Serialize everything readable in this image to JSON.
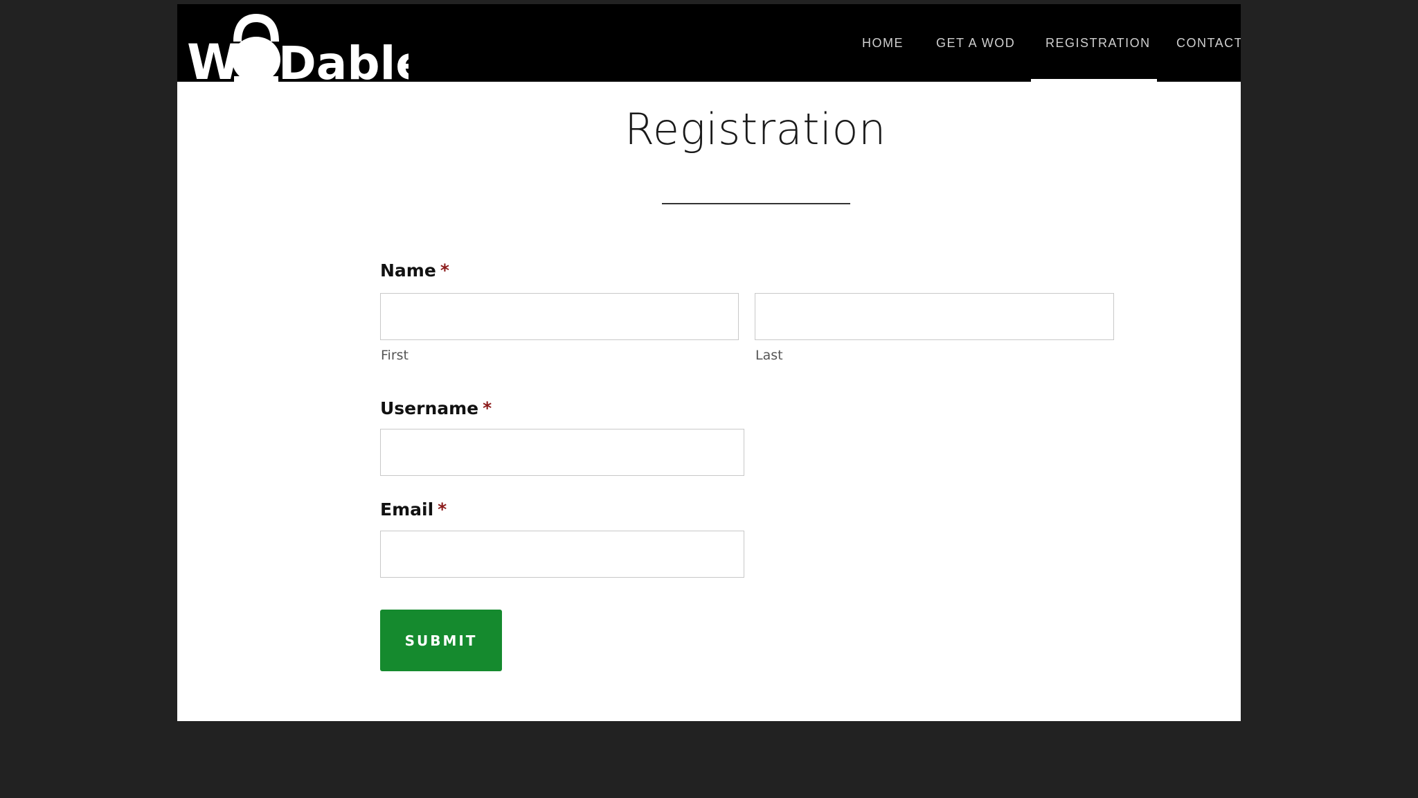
{
  "site": {
    "logo_text": "WODables",
    "logo_icon": "kettlebell-icon"
  },
  "nav": {
    "items": [
      {
        "label": "HOME",
        "active": false
      },
      {
        "label": "GET A WOD",
        "active": false
      },
      {
        "label": "REGISTRATION",
        "active": true
      },
      {
        "label": "CONTACT",
        "active": false
      }
    ]
  },
  "page": {
    "title": "Registration"
  },
  "form": {
    "required_marker": "*",
    "name": {
      "label": "Name",
      "first_value": "",
      "first_sublabel": "First",
      "last_value": "",
      "last_sublabel": "Last"
    },
    "username": {
      "label": "Username",
      "value": ""
    },
    "email": {
      "label": "Email",
      "value": ""
    },
    "submit_label": "SUBMIT"
  },
  "colors": {
    "header_bg": "#000000",
    "page_bg": "#222222",
    "submit_bg": "#158a2e",
    "required_marker": "#8b1a1a"
  }
}
